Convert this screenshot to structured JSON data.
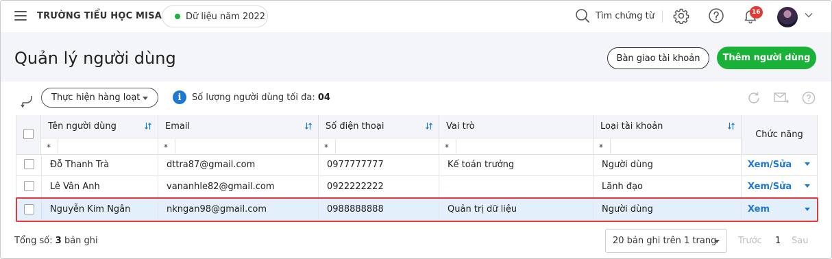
{
  "header": {
    "school_name": "TRƯỜNG TIỂU HỌC MISA",
    "year_label": "Dữ liệu năm 2022",
    "search_label": "Tìm chứng từ",
    "notification_count": "16"
  },
  "page": {
    "title": "Quản lý người dùng",
    "handover_button": "Bàn giao tài khoản",
    "add_user_button": "Thêm người dùng"
  },
  "toolbar": {
    "bulk_action_label": "Thực hiện hàng loạt",
    "max_users_label": "Số lượng người dùng tối đa:",
    "max_users_value": "04"
  },
  "table": {
    "columns": [
      {
        "label": "Tên người dùng"
      },
      {
        "label": "Email"
      },
      {
        "label": "Số điện thoại"
      },
      {
        "label": "Vai trò"
      },
      {
        "label": "Loại tài khoản"
      },
      {
        "label": "Chức năng"
      }
    ],
    "filter_symbol": "*",
    "rows": [
      {
        "name": "Đỗ Thanh Trà",
        "email": "dttra87@gmail.com",
        "phone": "0977777777",
        "role": "Kế toán trưởng",
        "account_type": "Người dùng",
        "action": "Xem/Sửa"
      },
      {
        "name": "Lê Vân Anh",
        "email": "vananhle82@gmail.com",
        "phone": "0922222222",
        "role": "",
        "account_type": "Lãnh đạo",
        "action": "Xem/Sửa"
      },
      {
        "name": "Nguyễn Kim Ngân",
        "email": "nkngan98@gmail.com",
        "phone": "0988888888",
        "role": "Quản trị dữ liệu",
        "account_type": "Người dùng",
        "action": "Xem"
      }
    ]
  },
  "footer": {
    "total_label": "Tổng số:",
    "total_value": "3",
    "total_suffix": "bản ghi",
    "page_size": "20 bản ghi trên 1 trang",
    "prev_label": "Trước",
    "current_page": "1",
    "next_label": "Sau"
  },
  "colors": {
    "brand_green": "#1ab138",
    "link_blue": "#1e78d2",
    "badge_red": "#e53935",
    "highlight_red": "#e0393e",
    "selected_row": "#e3f0fb"
  }
}
